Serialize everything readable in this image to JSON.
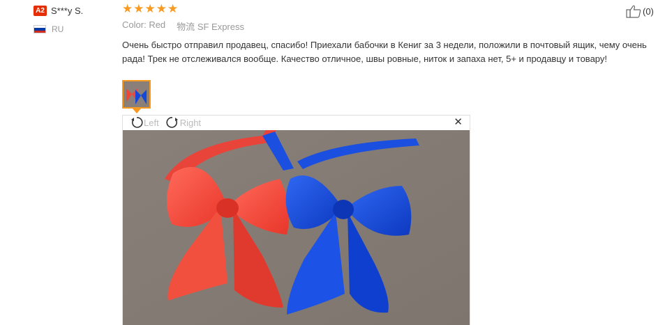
{
  "reviewer": {
    "level_badge": "A2",
    "name": "S***y S.",
    "country_code": "RU",
    "flag_colors": [
      "#ffffff",
      "#0039a6",
      "#d52b1e"
    ]
  },
  "review": {
    "rating": 5,
    "color_label": "Color:",
    "color_value": "Red",
    "shipping_label": "物流",
    "shipping_value": "SF Express",
    "text": "Очень быстро отправил продавец, спасибо! Приехали бабочки в Кениг за 3 недели, положили в почтовый ящик, чему очень рада! Трек не отслеживался вообще. Качество отличное, швы ровные, ниток и запаха нет, 5+ и продавцу и товару!"
  },
  "viewer": {
    "rotate_left_label": "Left",
    "rotate_right_label": "Right",
    "close_icon": "close-icon"
  },
  "helpful": {
    "count": "(0)"
  },
  "colors": {
    "star": "#f79a1f",
    "badge": "#e62e04",
    "bow_red": "#f0463a",
    "bow_blue": "#1448d8",
    "background_photo": "#8b8079"
  }
}
